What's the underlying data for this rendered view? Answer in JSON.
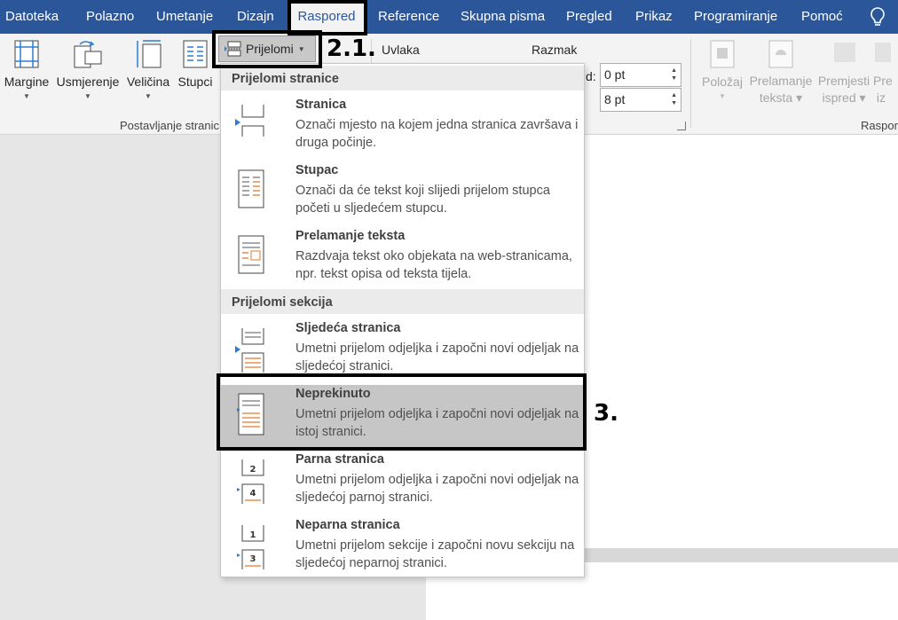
{
  "menu": {
    "tabs": [
      {
        "label": "Datoteka"
      },
      {
        "label": "Polazno"
      },
      {
        "label": "Umetanje"
      },
      {
        "label": "Dizajn"
      },
      {
        "label": "Raspored"
      },
      {
        "label": "Reference"
      },
      {
        "label": "Skupna pisma"
      },
      {
        "label": "Pregled"
      },
      {
        "label": "Prikaz"
      },
      {
        "label": "Programiranje"
      },
      {
        "label": "Pomoć"
      }
    ],
    "active_tab": "Raspored",
    "tell_me_icon": "lightbulb-icon"
  },
  "ribbon": {
    "page_setup": {
      "margins": "Margine",
      "orientation": "Usmjerenje",
      "size": "Veličina",
      "columns": "Stupci",
      "group_label": "Postavljanje stranice",
      "group_label_visible": "Postavljanje stranic"
    },
    "breaks_button": "Prijelomi",
    "paragraph": {
      "indent_label": "Uvlaka",
      "spacing_label": "Razmak",
      "before_label_fragment": "d:",
      "before_value": "0 pt",
      "after_value": "8 pt"
    },
    "arrange": {
      "position": "Položaj",
      "wrap_line1": "Prelamanje",
      "wrap_line2": "teksta",
      "bring_line1": "Premjesti",
      "bring_line2": "ispred",
      "send_line1": "Pre",
      "send_line2": "iz",
      "group_label": "Raspor"
    }
  },
  "dropdown": {
    "page_breaks_header": "Prijelomi stranice",
    "section_breaks_header": "Prijelomi sekcija",
    "items": [
      {
        "title": "Stranica",
        "desc": "Označi mjesto na kojem jedna stranica završava i druga počinje.",
        "icon": "page-break-icon"
      },
      {
        "title": "Stupac",
        "desc": "Označi da će tekst koji slijedi prijelom stupca početi u sljedećem stupcu.",
        "icon": "column-break-icon"
      },
      {
        "title": "Prelamanje teksta",
        "desc": "Razdvaja tekst oko objekata na web-stranicama, npr. tekst opisa od teksta tijela.",
        "icon": "text-wrapping-icon"
      },
      {
        "title": "Sljedeća stranica",
        "desc": "Umetni prijelom odjeljka i započni novi odjeljak na sljedećoj stranici.",
        "icon": "next-page-icon"
      },
      {
        "title": "Neprekinuto",
        "desc": "Umetni prijelom odjeljka i započni novi odjeljak na istoj stranici.",
        "icon": "continuous-icon"
      },
      {
        "title": "Parna stranica",
        "desc": "Umetni prijelom odjeljka i započni novi odjeljak na sljedećoj parnoj stranici.",
        "icon": "even-page-icon"
      },
      {
        "title": "Neparna stranica",
        "desc": "Umetni prijelom sekcije i započni novu sekciju na sljedećoj neparnoj stranici.",
        "icon": "odd-page-icon"
      }
    ],
    "highlighted_item": "Neprekinuto"
  },
  "annotations": {
    "step_breaks": "2.1.",
    "step_continuous": "3."
  },
  "colors": {
    "menu_bar": "#2b579a",
    "ribbon": "#f3f3f3",
    "highlight": "#c6c6c6",
    "icon_accent": "#e07a2e"
  }
}
